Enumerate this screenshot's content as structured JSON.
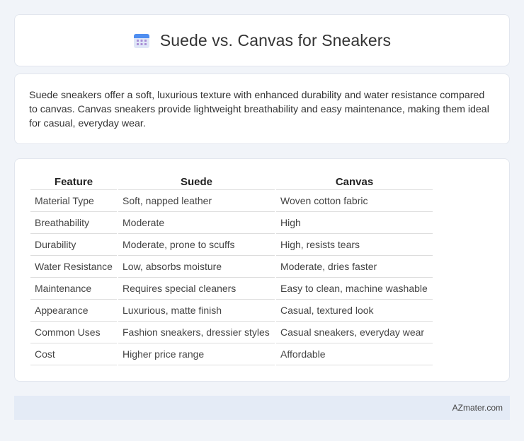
{
  "header": {
    "title": "Suede vs. Canvas for Sneakers",
    "icon": "calendar-icon"
  },
  "intro": {
    "text": "Suede sneakers offer a soft, luxurious texture with enhanced durability and water resistance compared to canvas. Canvas sneakers provide lightweight breathability and easy maintenance, making them ideal for casual, everyday wear."
  },
  "table": {
    "headers": [
      "Feature",
      "Suede",
      "Canvas"
    ],
    "rows": [
      [
        "Material Type",
        "Soft, napped leather",
        "Woven cotton fabric"
      ],
      [
        "Breathability",
        "Moderate",
        "High"
      ],
      [
        "Durability",
        "Moderate, prone to scuffs",
        "High, resists tears"
      ],
      [
        "Water Resistance",
        "Low, absorbs moisture",
        "Moderate, dries faster"
      ],
      [
        "Maintenance",
        "Requires special cleaners",
        "Easy to clean, machine washable"
      ],
      [
        "Appearance",
        "Luxurious, matte finish",
        "Casual, textured look"
      ],
      [
        "Common Uses",
        "Fashion sneakers, dressier styles",
        "Casual sneakers, everyday wear"
      ],
      [
        "Cost",
        "Higher price range",
        "Affordable"
      ]
    ]
  },
  "footer": {
    "text": "AZmater.com"
  }
}
